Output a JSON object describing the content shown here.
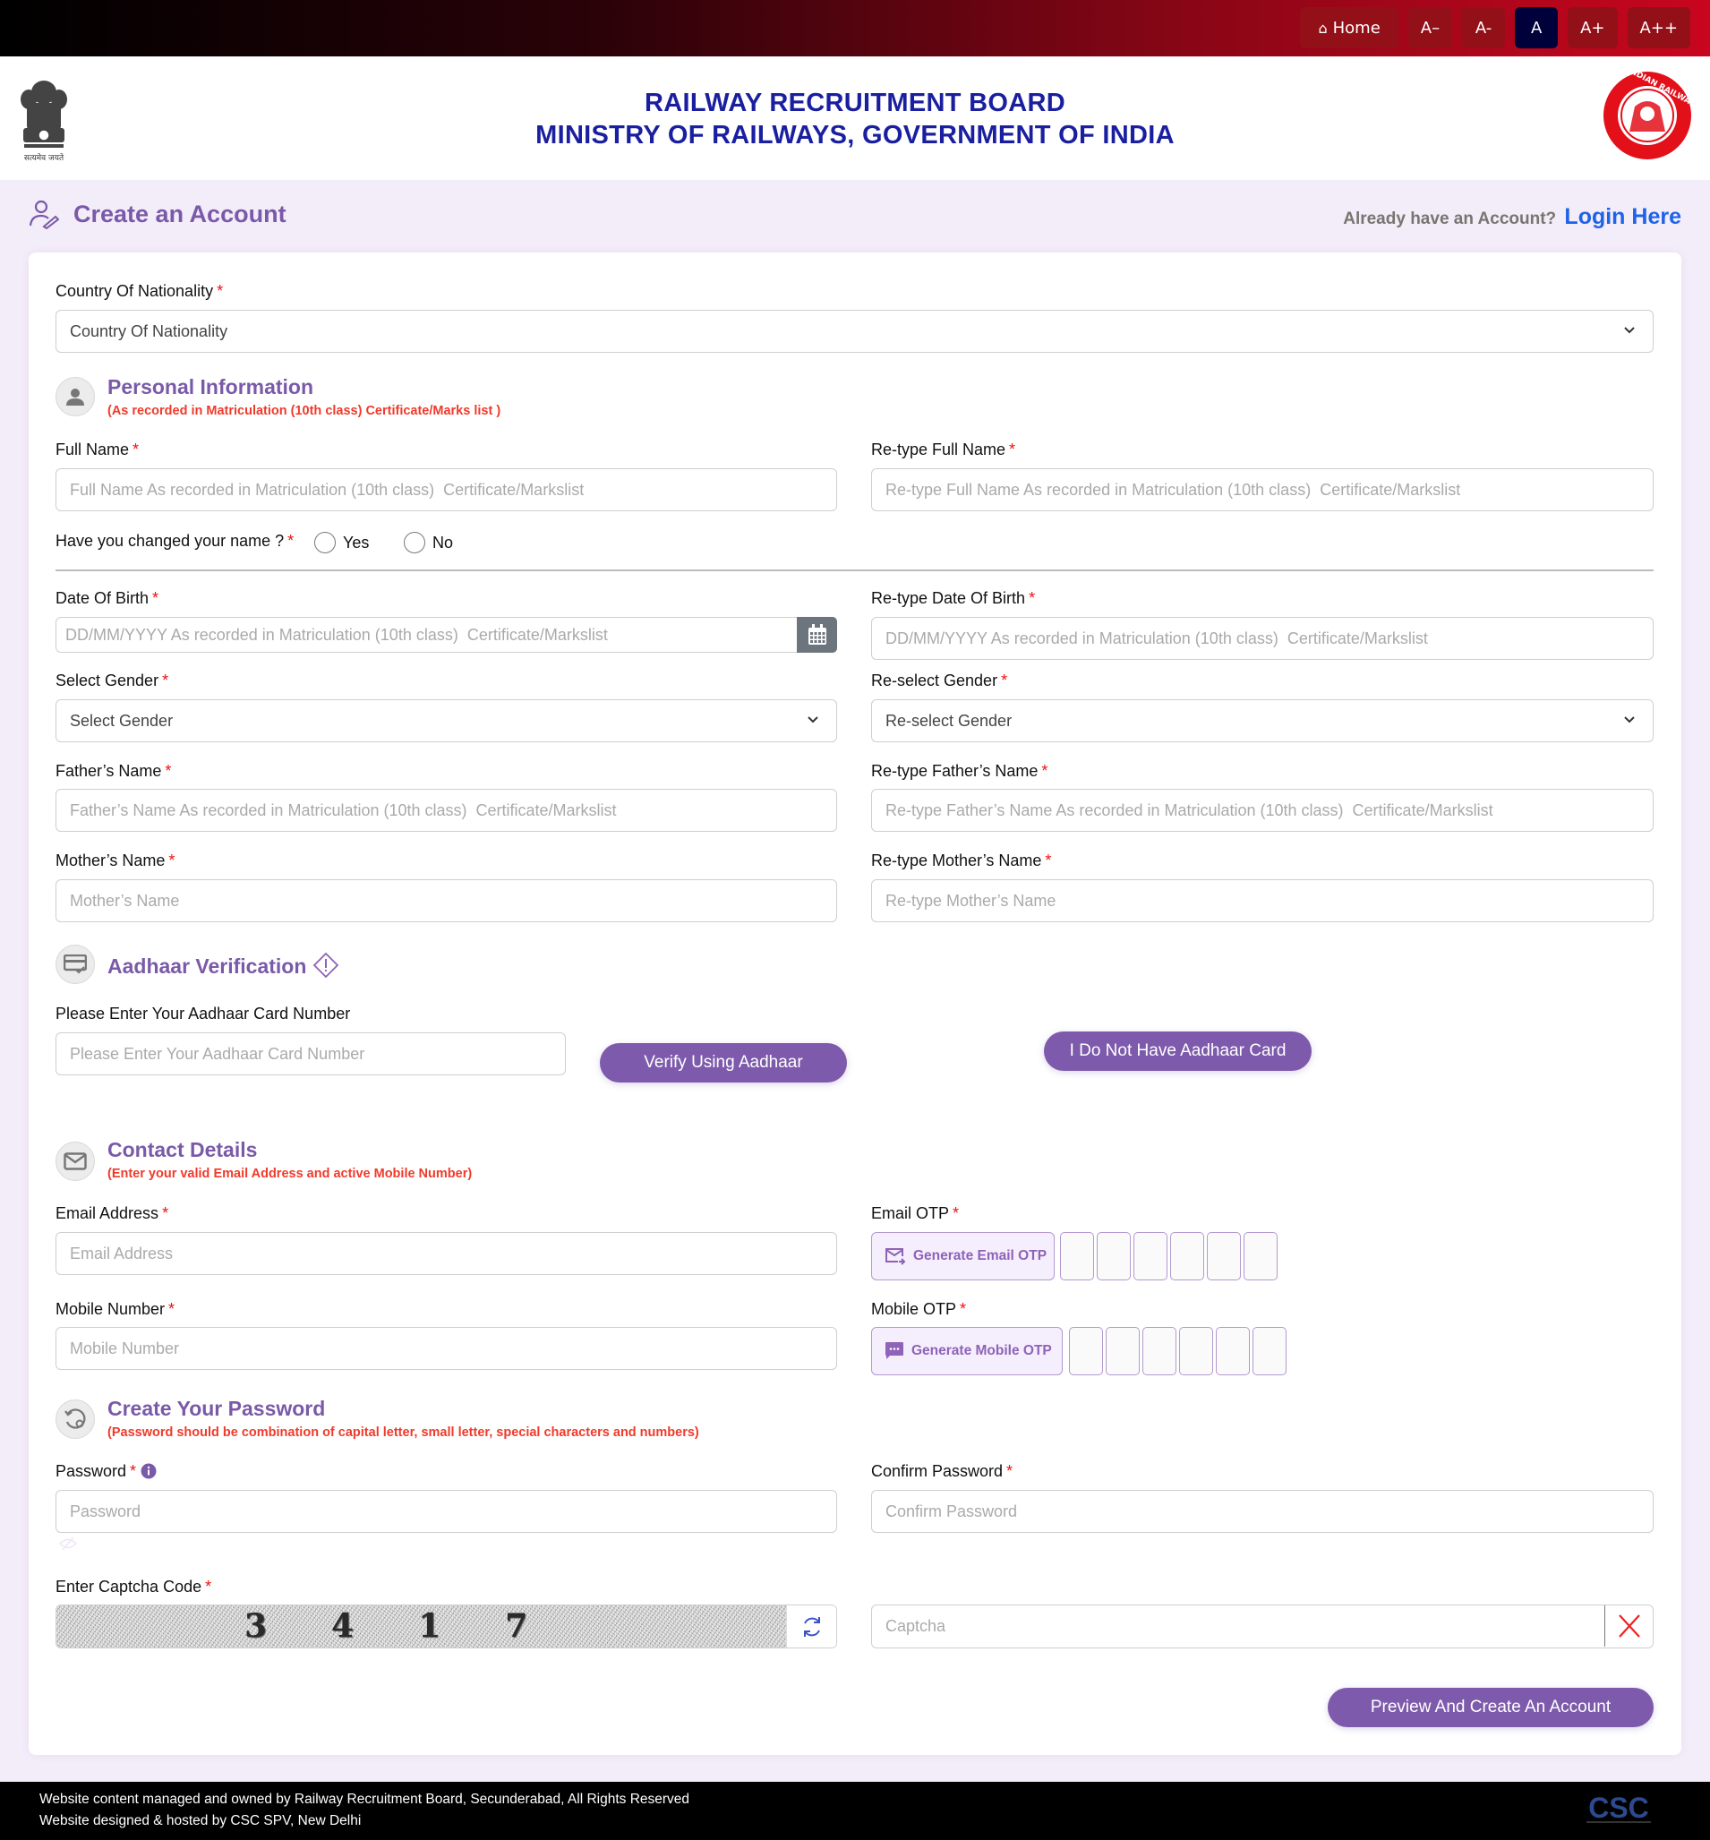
{
  "topbar": {
    "home_label": "Home",
    "font_buttons": [
      "A–",
      "A-",
      "A",
      "A+",
      "A++"
    ],
    "active_font_index": 2
  },
  "header": {
    "title_line1": "RAILWAY RECRUITMENT BOARD",
    "title_line2": "MINISTRY OF RAILWAYS, GOVERNMENT OF INDIA",
    "emblem_caption": "सत्यमेव जयते",
    "railway_logo_text": "INDIAN RAILWAYS"
  },
  "page": {
    "title": "Create an Account",
    "login_prompt": "Already have an Account?",
    "login_link": "Login Here"
  },
  "nationality": {
    "label": "Country Of Nationality",
    "selected": "Country Of Nationality"
  },
  "personal": {
    "title": "Personal Information",
    "subtitle": "(As recorded in Matriculation (10th class) Certificate/Marks list )",
    "full_name": {
      "label": "Full Name",
      "placeholder": "Full Name As recorded in Matriculation (10th class)  Certificate/Markslist"
    },
    "retype_full_name": {
      "label": "Re-type Full Name",
      "placeholder": "Re-type Full Name As recorded in Matriculation (10th class)  Certificate/Markslist"
    },
    "name_changed": {
      "label": "Have you changed your name ?",
      "options": [
        "Yes",
        "No"
      ]
    },
    "dob": {
      "label": "Date Of Birth",
      "placeholder": "DD/MM/YYYY As recorded in Matriculation (10th class)  Certificate/Markslist"
    },
    "retype_dob": {
      "label": "Re-type Date Of Birth",
      "placeholder": "DD/MM/YYYY As recorded in Matriculation (10th class)  Certificate/Markslist"
    },
    "gender": {
      "label": "Select Gender",
      "selected": "Select Gender"
    },
    "regender": {
      "label": "Re-select Gender",
      "selected": "Re-select Gender"
    },
    "father": {
      "label": "Father’s Name",
      "placeholder": "Father’s Name As recorded in Matriculation (10th class)  Certificate/Markslist"
    },
    "retype_father": {
      "label": "Re-type Father’s Name",
      "placeholder": "Re-type Father’s Name As recorded in Matriculation (10th class)  Certificate/Markslist"
    },
    "mother": {
      "label": "Mother’s Name",
      "placeholder": "Mother’s Name"
    },
    "retype_mother": {
      "label": "Re-type Mother’s Name",
      "placeholder": "Re-type Mother’s Name"
    }
  },
  "aadhaar": {
    "title": "Aadhaar Verification",
    "label": "Please Enter Your Aadhaar Card Number",
    "placeholder": "Please Enter Your Aadhaar Card Number",
    "verify_button": "Verify Using Aadhaar",
    "no_aadhaar_button": "I Do Not Have Aadhaar Card"
  },
  "contact": {
    "title": "Contact Details",
    "subtitle": "(Enter your valid Email Address and active Mobile Number)",
    "email": {
      "label": "Email Address",
      "placeholder": "Email Address"
    },
    "email_otp": {
      "label": "Email OTP",
      "button": "Generate Email OTP",
      "digits": 6
    },
    "mobile": {
      "label": "Mobile Number",
      "placeholder": "Mobile Number"
    },
    "mobile_otp": {
      "label": "Mobile OTP",
      "button": "Generate Mobile OTP",
      "digits": 6
    }
  },
  "password": {
    "title": "Create Your Password",
    "subtitle": "(Password should be combination of capital letter, small letter, special characters and numbers)",
    "password": {
      "label": "Password",
      "placeholder": "Password"
    },
    "confirm": {
      "label": "Confirm Password",
      "placeholder": "Confirm Password"
    }
  },
  "captcha": {
    "label": "Enter Captcha Code",
    "code": "3417",
    "placeholder": "Captcha"
  },
  "submit_button": "Preview And Create An Account",
  "footer": {
    "line1": "Website content managed and owned by Railway Recruitment Board, Secunderabad, All Rights Reserved",
    "line2": "Website designed & hosted by CSC SPV, New Delhi",
    "logo_text": "CSC"
  },
  "colors": {
    "accent_purple": "#7d5aab",
    "heading_purple": "#7a5aa8",
    "required_red": "#e11111",
    "note_red": "#f03a2a",
    "link_blue": "#1e63e8",
    "header_navy": "#1a1fa0"
  }
}
